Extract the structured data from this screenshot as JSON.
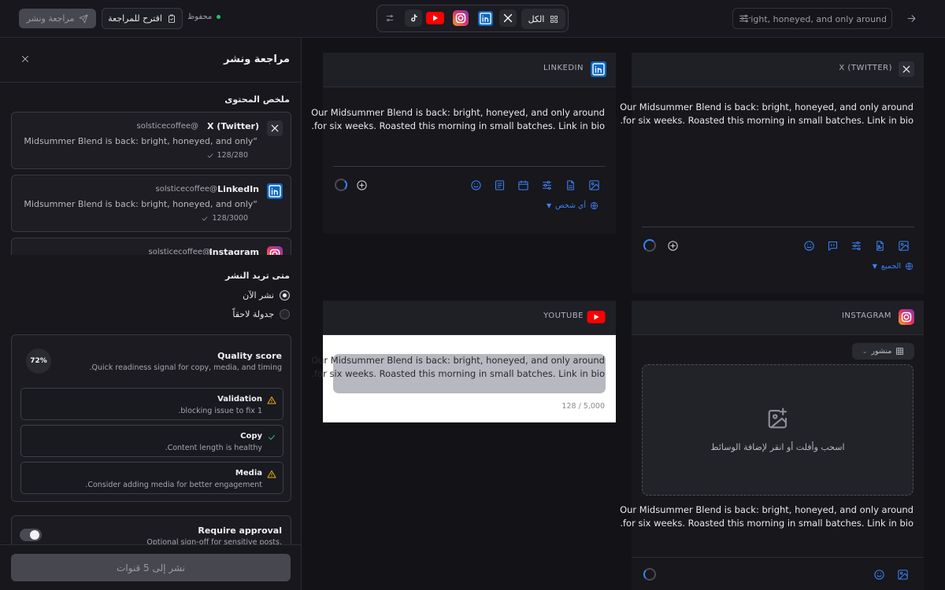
{
  "topbar": {
    "review_button": "مراجعة ونشر",
    "suggest_button": "اقترح للمراجعة",
    "saved_status": "محفوظ",
    "all_tab": "الكل",
    "search_value": "bright, honeyed, and only around"
  },
  "panel": {
    "title": "مراجعة ونشر",
    "summary_title": "ملخص المحتوى",
    "cards": [
      {
        "platform": "X (Twitter)",
        "handle": "solsticecoffee@",
        "excerpt": "“Our Midsummer Blend is back: bright, honeyed, and only",
        "count": "128/280"
      },
      {
        "platform": "LinkedIn",
        "handle": "solsticecoffee@",
        "excerpt": "“Our Midsummer Blend is back: bright, honeyed, and only",
        "count": "128/3000"
      },
      {
        "platform": "Instagram",
        "handle": "solsticecoffee@"
      }
    ],
    "when_title": "متى تريد النشر",
    "options": {
      "now": "نشر الآن",
      "later": "جدولة لاحقاً"
    },
    "quality": {
      "title": "Quality score",
      "subtitle": "Quick readiness signal for copy, media, and timing.",
      "score": "72%",
      "items": [
        {
          "title": "Validation",
          "desc": "1 blocking issue to fix.",
          "status": "warning"
        },
        {
          "title": "Copy",
          "desc": "Content length is healthy.",
          "status": "ok"
        },
        {
          "title": "Media",
          "desc": "Consider adding media for better engagement.",
          "status": "warning"
        }
      ]
    },
    "approval": {
      "title": "Require approval",
      "desc": "Optional sign-off for sensitive posts."
    },
    "publish_button": "نشر إلى 5 قنوات"
  },
  "editors": {
    "post_line1": "Our Midsummer Blend is back: bright, honeyed, and only around",
    "post_line2": "for six weeks. Roasted this morning in small batches. Link in bio.",
    "linkedin": {
      "label": "LINKEDIN",
      "audience": "أي شخص"
    },
    "twitter": {
      "label": "X (TWITTER)",
      "audience": "الجميع"
    },
    "youtube": {
      "label": "YOUTUBE",
      "count": "128 / 5,000"
    },
    "instagram": {
      "label": "INSTAGRAM",
      "post_type": "منشور",
      "drop_text": "اسحب وأفلت أو انقر لإضافة الوسائط"
    }
  },
  "colors": {
    "accent": "#3b82f6",
    "youtube": "#ff0000",
    "linkedin": "#0a66c2",
    "success": "#22c55e",
    "warning": "#eab308"
  }
}
